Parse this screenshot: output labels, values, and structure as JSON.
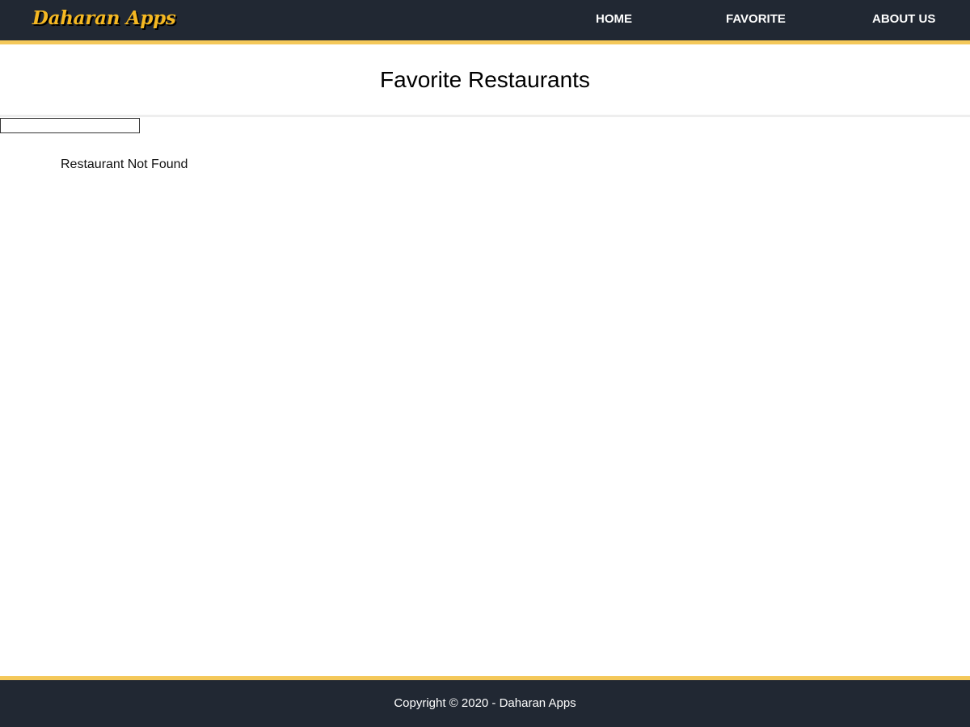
{
  "header": {
    "brand": "Daharan Apps",
    "nav": {
      "home": "HOME",
      "favorite": "FAVORITE",
      "about": "ABOUT US"
    }
  },
  "main": {
    "title": "Favorite Restaurants",
    "search": {
      "value": "",
      "placeholder": ""
    },
    "empty_message": "Restaurant Not Found"
  },
  "footer": {
    "copyright": "Copyright © 2020 - Daharan Apps"
  },
  "colors": {
    "header_bg": "#212833",
    "accent": "#f4c85a",
    "brand": "#f5b822"
  }
}
